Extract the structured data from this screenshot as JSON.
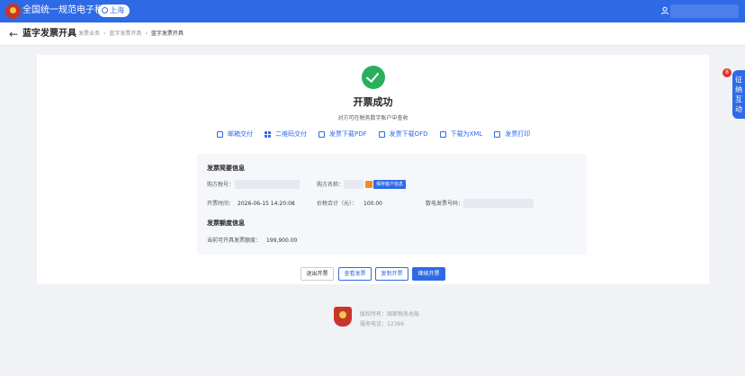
{
  "header": {
    "app_title": "全国统一规范电子税务局",
    "region": "上海"
  },
  "subheader": {
    "back_glyph": "←",
    "page_title": "蓝字发票开具",
    "breadcrumb": [
      "发票业务",
      "蓝字发票开具",
      "蓝字发票开具"
    ]
  },
  "result": {
    "title": "开票成功",
    "subtitle": "对方可在税务数字账户中查收"
  },
  "actions": [
    {
      "label": "邮箱交付",
      "icon": "mail-icon"
    },
    {
      "label": "二维码交付",
      "icon": "qrcode-icon"
    },
    {
      "label": "发票下载PDF",
      "icon": "pdf-icon"
    },
    {
      "label": "发票下载OFD",
      "icon": "ofd-icon"
    },
    {
      "label": "下载为XML",
      "icon": "xml-icon"
    },
    {
      "label": "发票打印",
      "icon": "printer-icon"
    }
  ],
  "invoice_info": {
    "title": "发票简要信息",
    "buyer_tax_id_label": "购方税号：",
    "buyer_name_label": "购方名称：",
    "save_customer_label": "保存客户信息",
    "issue_time_label": "开票时间：",
    "issue_time_value": "2026-06-15 14:20:08",
    "total_label": "价税合计（元）：",
    "total_value": "100.00",
    "invoice_no_label": "数电发票号码："
  },
  "quota_info": {
    "title": "发票额度信息",
    "available_label": "当前可开具发票额度：",
    "available_value": "199,900.00"
  },
  "buttons": {
    "exit": "退出开票",
    "view": "查看发票",
    "copy": "复制开票",
    "continue": "继续开票"
  },
  "footer": {
    "copyright": "版权所有：国家税务总局",
    "hotline": "服务电话：12366"
  },
  "side_widget": {
    "label_chars": [
      "征",
      "纳",
      "互",
      "动"
    ],
    "badge": "8"
  },
  "colors": {
    "brand_blue": "#2f6ae6",
    "success_green": "#29b05c",
    "badge_red": "#e5322d"
  }
}
